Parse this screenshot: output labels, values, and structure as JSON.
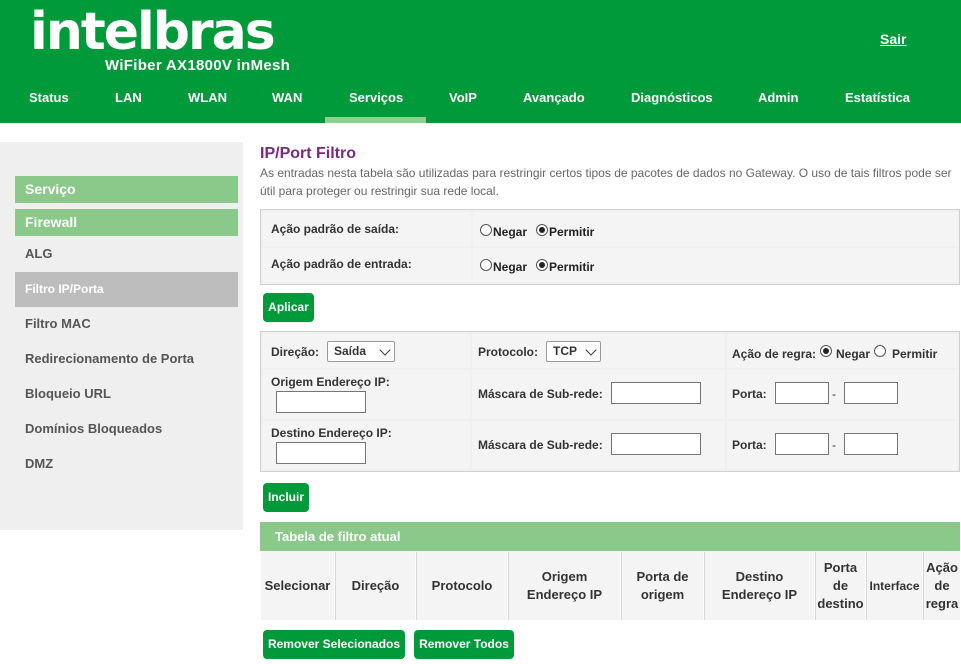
{
  "header": {
    "logo": "intelbras",
    "model": "WiFiber AX1800V inMesh",
    "logout": "Sair",
    "nav": [
      "Status",
      "LAN",
      "WLAN",
      "WAN",
      "Serviços",
      "VoIP",
      "Avançado",
      "Diagnósticos",
      "Admin",
      "Estatística"
    ],
    "active_nav": "Serviços"
  },
  "sidebar": {
    "section": "Serviço",
    "subsection": "Firewall",
    "items": [
      "ALG",
      "Filtro IP/Porta",
      "Filtro MAC",
      "Redirecionamento de Porta",
      "Bloqueio URL",
      "Domínios Bloqueados",
      "DMZ"
    ],
    "active_item": "Filtro IP/Porta"
  },
  "main": {
    "title": "IP/Port Filtro",
    "description": "As entradas nesta tabela são utilizadas para restringir certos tipos de pacotes de dados no Gateway. O uso de tais filtros pode ser útil para proteger ou restringir sua rede local.",
    "default_actions": {
      "outgoing_label": "Ação padrão de saída:",
      "incoming_label": "Ação padrão de entrada:",
      "deny": "Negar",
      "allow": "Permitir",
      "outgoing_value": "Permitir",
      "incoming_value": "Permitir"
    },
    "apply_button": "Aplicar",
    "rule_form": {
      "direction_label": "Direção:",
      "direction_value": "Saída",
      "protocol_label": "Protocolo:",
      "protocol_value": "TCP",
      "rule_action_label": "Ação de regra:",
      "deny": "Negar",
      "allow": "Permitir",
      "rule_action_value": "Negar",
      "src_ip_label": "Origem Endereço IP:",
      "dst_ip_label": "Destino Endereço IP:",
      "mask_label": "Máscara de Sub-rede:",
      "port_label": "Porta:",
      "range_sep": "-",
      "src_ip": "",
      "src_mask": "",
      "src_port_from": "",
      "src_port_to": "",
      "dst_ip": "",
      "dst_mask": "",
      "dst_port_from": "",
      "dst_port_to": ""
    },
    "add_button": "Incluir",
    "table": {
      "title": "Tabela de filtro atual",
      "columns": [
        "Selecionar",
        "Direção",
        "Protocolo",
        "Origem Endereço IP",
        "Porta de origem",
        "Destino Endereço IP",
        "Porta de destino",
        "Interface",
        "Ação de regra"
      ],
      "rows": []
    },
    "remove_selected_button": "Remover Selecionados",
    "remove_all_button": "Remover Todos"
  },
  "colors": {
    "brand_green": "#009a3a",
    "light_green": "#8bc98a",
    "title_purple": "#7a2a7a"
  }
}
